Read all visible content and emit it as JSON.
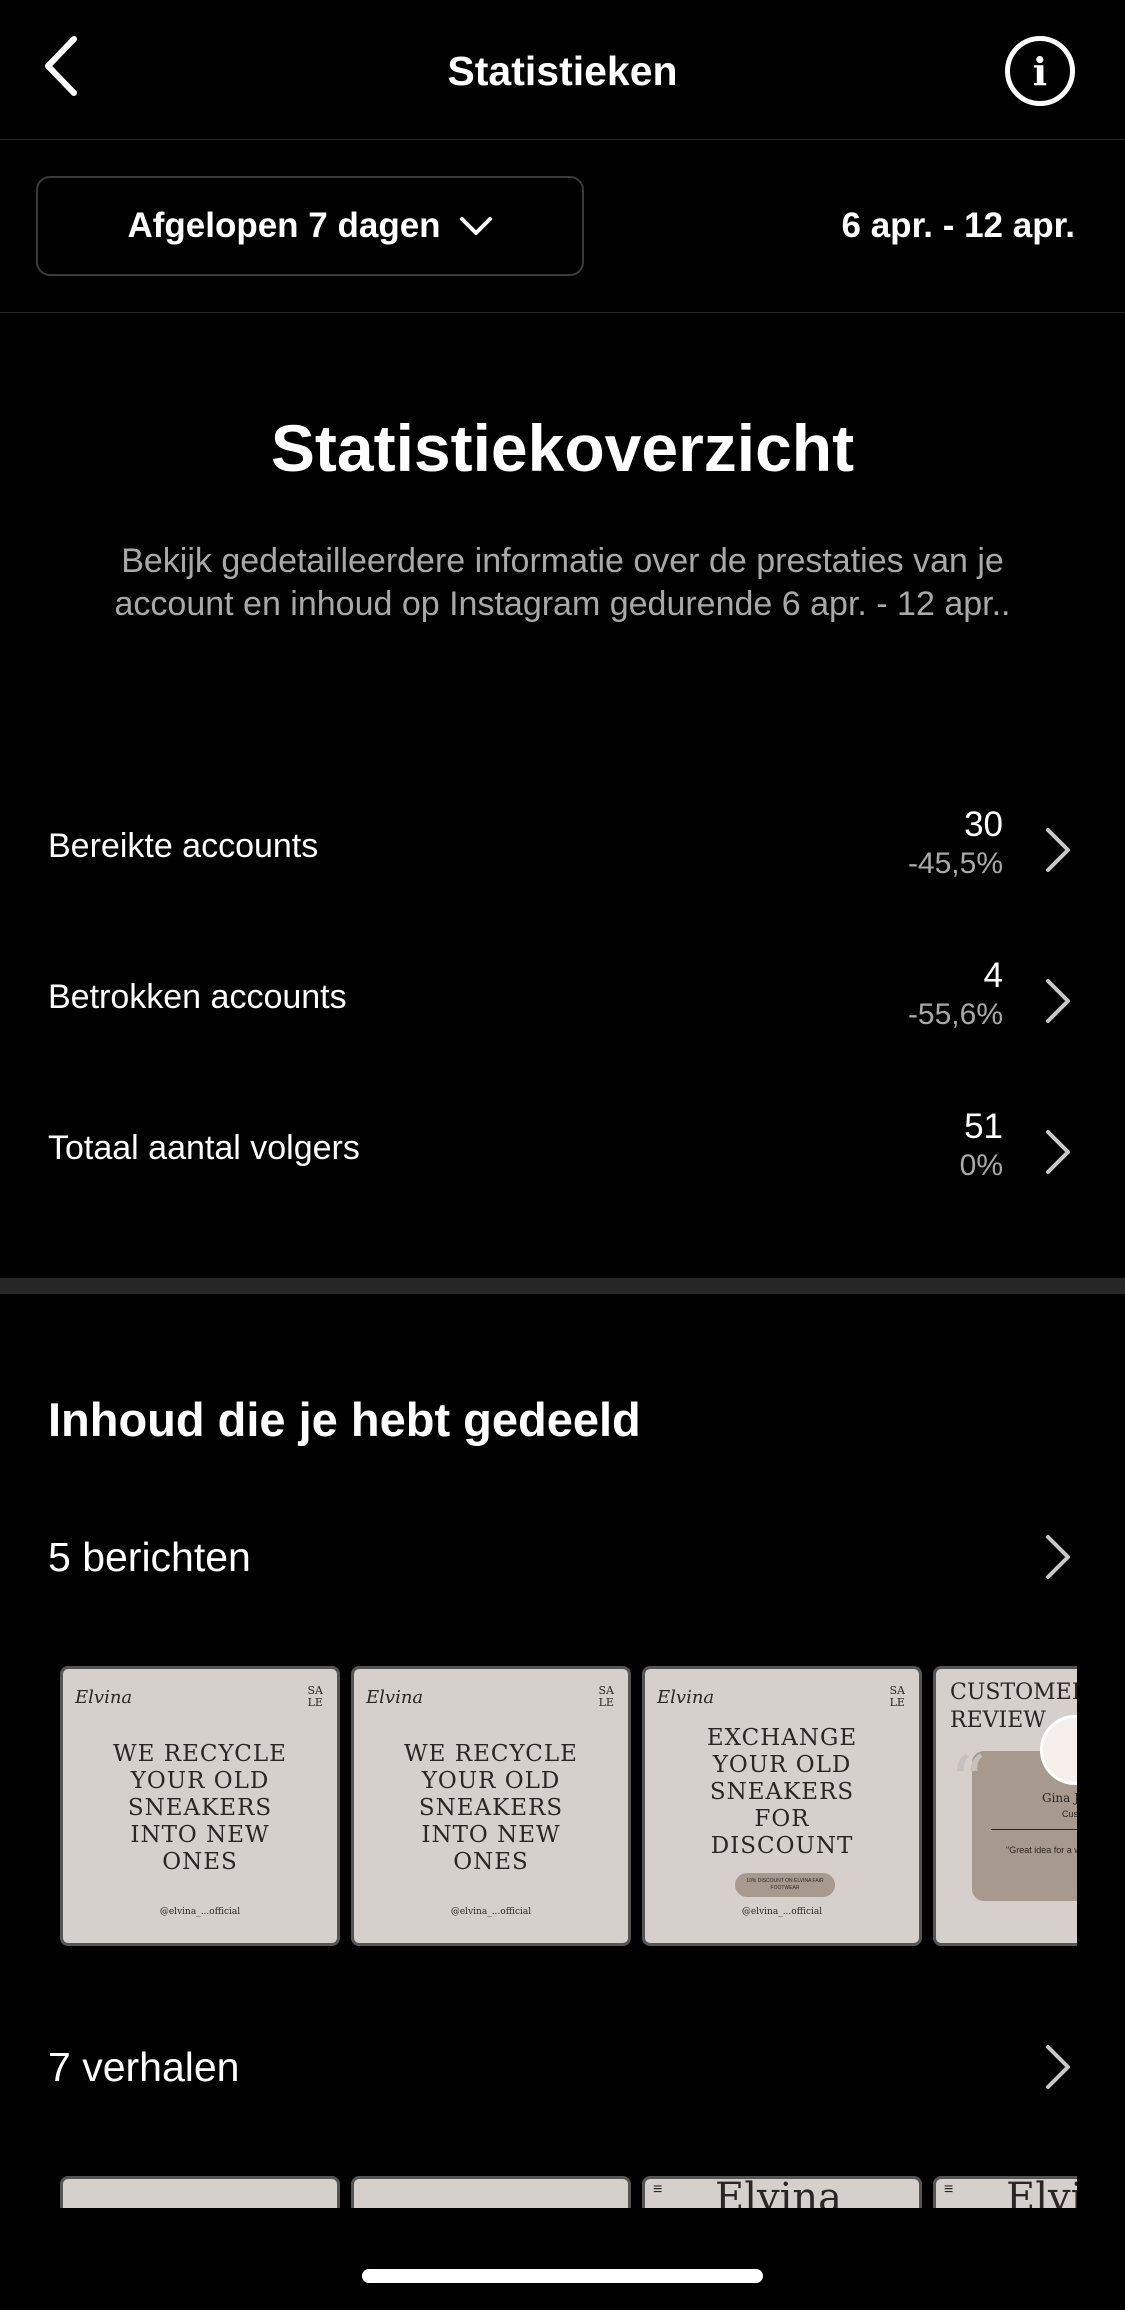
{
  "header": {
    "title": "Statistieken",
    "back_icon": "chevron-left-icon",
    "info_icon": "info-icon",
    "info_glyph": "i"
  },
  "filter": {
    "range_label": "Afgelopen 7 dagen",
    "dropdown_icon": "chevron-down-icon",
    "date_range": "6 apr. - 12 apr."
  },
  "overview": {
    "title": "Statistiekoverzicht",
    "description": "Bekijk gedetailleerdere informatie over de prestaties van je account en inhoud op Instagram gedurende 6 apr. - 12 apr.."
  },
  "metrics": [
    {
      "label": "Bereikte accounts",
      "value": "30",
      "change": "-45,5%"
    },
    {
      "label": "Betrokken accounts",
      "value": "4",
      "change": "-55,6%"
    },
    {
      "label": "Totaal aantal volgers",
      "value": "51",
      "change": "0%"
    }
  ],
  "content": {
    "section_title": "Inhoud die je hebt gedeeld",
    "posts_label": "5 berichten",
    "stories_label": "7 verhalen"
  },
  "posts": [
    {
      "brand": "Elvina",
      "corner": "SA\nLE",
      "headline": "WE RECYCLE\nYOUR OLD\nSNEAKERS\nINTO NEW\nONES",
      "handle": "@elvina_...official"
    },
    {
      "brand": "Elvina",
      "corner": "SA\nLE",
      "headline": "WE RECYCLE\nYOUR OLD\nSNEAKERS\nINTO NEW\nONES",
      "handle": "@elvina_...official"
    },
    {
      "brand": "Elvina",
      "corner": "SA\nLE",
      "headline": "EXCHANGE\nYOUR OLD\nSNEAKERS\nFOR\nDISCOUNT",
      "pill": "10% DISCOUNT ON ELVINA FAIR FOOTWEAR",
      "handle": "@elvina_...official"
    },
    {
      "title": "CUSTOMER\nREVIEW",
      "name": "Gina Ja",
      "sub": "Custo",
      "text": "\"Great idea for a wait to order my soon!\""
    }
  ],
  "stories": [
    {
      "brand": ""
    },
    {
      "brand": ""
    },
    {
      "brand": "Elvina",
      "menu": "≡"
    },
    {
      "brand": "Elvi",
      "menu": "≡"
    }
  ],
  "colors": {
    "background": "#000000",
    "muted_text": "#a8a8a8",
    "divider": "#262626",
    "thumb_bg": "#d6d0cc",
    "accent_card": "#a8998e"
  }
}
